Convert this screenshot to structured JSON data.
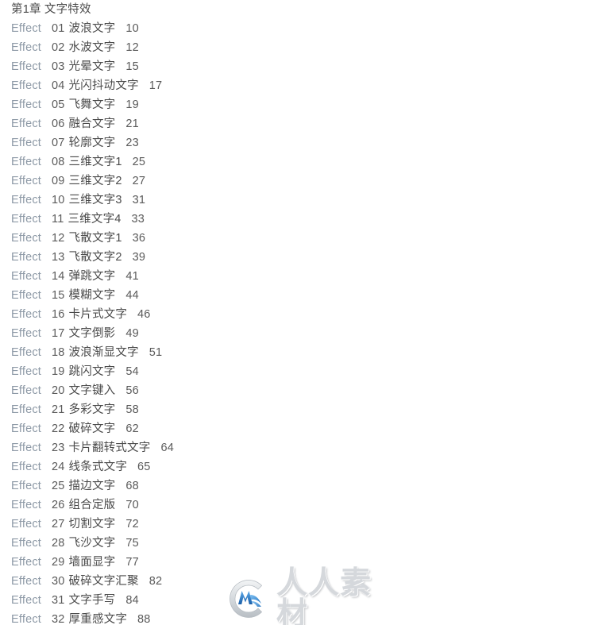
{
  "document": {
    "chapter_title": "第1章 文字特效",
    "entry_label": "Effect"
  },
  "toc": {
    "entries": [
      {
        "label": "Effect",
        "number": "01",
        "name": "波浪文字",
        "page": "10"
      },
      {
        "label": "Effect",
        "number": "02",
        "name": "水波文字",
        "page": "12"
      },
      {
        "label": "Effect",
        "number": "03",
        "name": "光晕文字",
        "page": "15"
      },
      {
        "label": "Effect",
        "number": "04",
        "name": "光闪抖动文字",
        "page": "17"
      },
      {
        "label": "Effect",
        "number": "05",
        "name": "飞舞文字",
        "page": "19"
      },
      {
        "label": "Effect",
        "number": "06",
        "name": "融合文字",
        "page": "21"
      },
      {
        "label": "Effect",
        "number": "07",
        "name": "轮廓文字",
        "page": "23"
      },
      {
        "label": "Effect",
        "number": "08",
        "name": "三维文字1",
        "page": "25"
      },
      {
        "label": "Effect",
        "number": "09",
        "name": "三维文字2",
        "page": "27"
      },
      {
        "label": "Effect",
        "number": "10",
        "name": "三维文字3",
        "page": "31"
      },
      {
        "label": "Effect",
        "number": "11",
        "name": "三维文字4",
        "page": "33"
      },
      {
        "label": "Effect",
        "number": "12",
        "name": "飞散文字1",
        "page": "36"
      },
      {
        "label": "Effect",
        "number": "13",
        "name": "飞散文字2",
        "page": "39"
      },
      {
        "label": "Effect",
        "number": "14",
        "name": "弹跳文字",
        "page": "41"
      },
      {
        "label": "Effect",
        "number": "15",
        "name": "模糊文字",
        "page": "44"
      },
      {
        "label": "Effect",
        "number": "16",
        "name": "卡片式文字",
        "page": "46"
      },
      {
        "label": "Effect",
        "number": "17",
        "name": "文字倒影",
        "page": "49"
      },
      {
        "label": "Effect",
        "number": "18",
        "name": "波浪渐显文字",
        "page": "51"
      },
      {
        "label": "Effect",
        "number": "19",
        "name": "跳闪文字",
        "page": "54"
      },
      {
        "label": "Effect",
        "number": "20",
        "name": "文字键入",
        "page": "56"
      },
      {
        "label": "Effect",
        "number": "21",
        "name": "多彩文字",
        "page": "58"
      },
      {
        "label": "Effect",
        "number": "22",
        "name": "破碎文字",
        "page": "62"
      },
      {
        "label": "Effect",
        "number": "23",
        "name": "卡片翻转式文字",
        "page": "64"
      },
      {
        "label": "Effect",
        "number": "24",
        "name": "线条式文字",
        "page": "65"
      },
      {
        "label": "Effect",
        "number": "25",
        "name": "描边文字",
        "page": "68"
      },
      {
        "label": "Effect",
        "number": "26",
        "name": "组合定版",
        "page": "70"
      },
      {
        "label": "Effect",
        "number": "27",
        "name": "切割文字",
        "page": "72"
      },
      {
        "label": "Effect",
        "number": "28",
        "name": "飞沙文字",
        "page": "75"
      },
      {
        "label": "Effect",
        "number": "29",
        "name": "墙面显字",
        "page": "77"
      },
      {
        "label": "Effect",
        "number": "30",
        "name": "破碎文字汇聚",
        "page": "82"
      },
      {
        "label": "Effect",
        "number": "31",
        "name": "文字手写",
        "page": "84"
      },
      {
        "label": "Effect",
        "number": "32",
        "name": "厚重感文字",
        "page": "88"
      }
    ]
  },
  "watermark": {
    "text": "人人素材",
    "logo_icon": "circle-m-logo-icon"
  },
  "colors": {
    "page_background": "#ffffff",
    "label_text": "#8d99a6",
    "body_text": "#4a4a4a",
    "number_text": "#5a5a5a",
    "watermark_text": "#d5d8dc",
    "watermark_logo_blue": "#2b7fd4",
    "watermark_logo_grey": "#c9ced3"
  }
}
